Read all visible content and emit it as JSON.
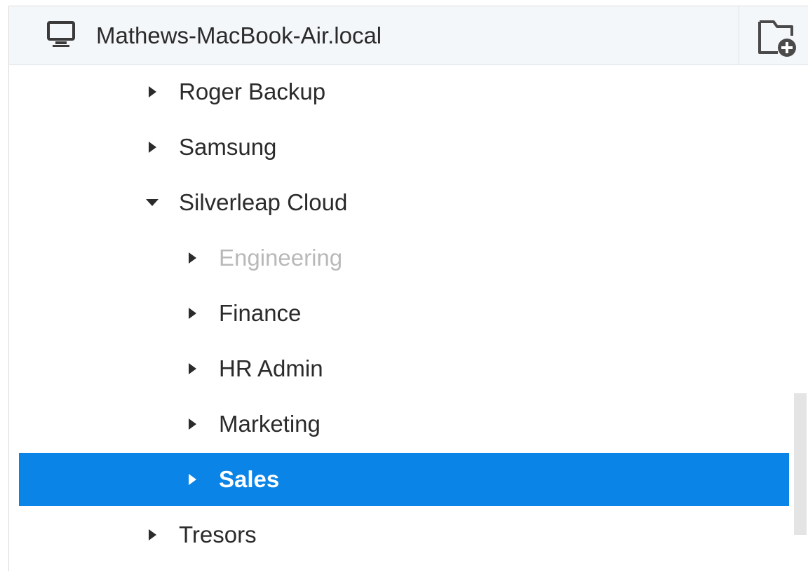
{
  "header": {
    "host_name": "Mathews-MacBook-Air.local",
    "host_icon": "computer-monitor-icon",
    "new_folder_icon": "folder-add-icon"
  },
  "tree": {
    "items": [
      {
        "label": "Roger Backup",
        "expanded": false,
        "level": 1,
        "state": "normal"
      },
      {
        "label": "Samsung",
        "expanded": false,
        "level": 1,
        "state": "normal"
      },
      {
        "label": "Silverleap Cloud",
        "expanded": true,
        "level": 1,
        "state": "normal"
      },
      {
        "label": "Engineering",
        "expanded": false,
        "level": 2,
        "state": "disabled"
      },
      {
        "label": "Finance",
        "expanded": false,
        "level": 2,
        "state": "normal"
      },
      {
        "label": "HR Admin",
        "expanded": false,
        "level": 2,
        "state": "normal"
      },
      {
        "label": "Marketing",
        "expanded": false,
        "level": 2,
        "state": "normal"
      },
      {
        "label": "Sales",
        "expanded": false,
        "level": 2,
        "state": "selected"
      },
      {
        "label": "Tresors",
        "expanded": false,
        "level": 1,
        "state": "normal"
      }
    ]
  },
  "colors": {
    "selection": "#0a84e6",
    "text": "#2b2b2b",
    "disabled_text": "#b9b9b9",
    "header_bg": "#f4f7fa"
  }
}
